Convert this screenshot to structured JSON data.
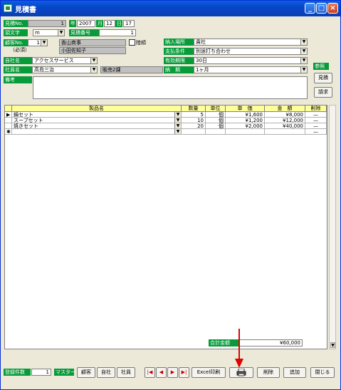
{
  "window": {
    "title": "見積書"
  },
  "header": {
    "estimate_no_label": "見積No.",
    "estimate_no_value": "1",
    "year_label": "年",
    "year_value": "2007",
    "month_label": "月",
    "month_value": "12",
    "day_label": "日",
    "day_value": "17",
    "prefix_label": "頭文字",
    "prefix_value": "m",
    "estimate_number_label": "見積番号",
    "estimate_number_value": "1",
    "customer_no_label": "顧客No.",
    "customer_no_value": "1",
    "customer_name": "香山商事",
    "customer_contact": "小田佐知子",
    "honorific_note": "（必須）",
    "landscape_label": "陸順",
    "company_label": "自社名",
    "company_value": "アクセスサービス",
    "staff_label": "社員名",
    "staff_value": "高島三治",
    "department_value": "販売2課",
    "notes_label": "備考",
    "notes_value": ""
  },
  "delivery": {
    "delivery_place_label": "納入場所",
    "delivery_place_value": "貴社",
    "payment_label": "支払条件",
    "payment_value": "別途打ち合わせ",
    "validity_label": "有効期限",
    "validity_value": "30日",
    "due_label": "納　期",
    "due_value": "1ヶ月"
  },
  "reference": {
    "label": "参照",
    "estimate_button": "見積",
    "invoice_button": "請求"
  },
  "table": {
    "headers": {
      "product": "製品名",
      "qty": "数量",
      "unit": "単位",
      "price": "単　価",
      "amount": "金　額",
      "delete": "削除"
    },
    "rows": [
      {
        "product": "鍋セット",
        "qty": "5",
        "unit": "個",
        "price": "¥1,600",
        "amount": "¥8,000"
      },
      {
        "product": "スープセット",
        "qty": "10",
        "unit": "個",
        "price": "¥1,200",
        "amount": "¥12,000"
      },
      {
        "product": "焼きセット",
        "qty": "20",
        "unit": "個",
        "price": "¥2,000",
        "amount": "¥40,000"
      }
    ],
    "total_label": "合計金額",
    "total_value": "¥60,000"
  },
  "footer": {
    "count_label": "登録件数",
    "count_value": "1",
    "master_label": "マスター",
    "customer_button": "顧客",
    "company_button": "自社",
    "staff_button": "社員",
    "excel_button": "Excel印刷",
    "print_icon": "printer-icon",
    "delete_button": "削除",
    "add_button": "追加",
    "close_button": "閉じる"
  },
  "colors": {
    "label_green": "#079b3a",
    "header_yellow": "#ffff9a",
    "arrow_red": "#e00000"
  }
}
